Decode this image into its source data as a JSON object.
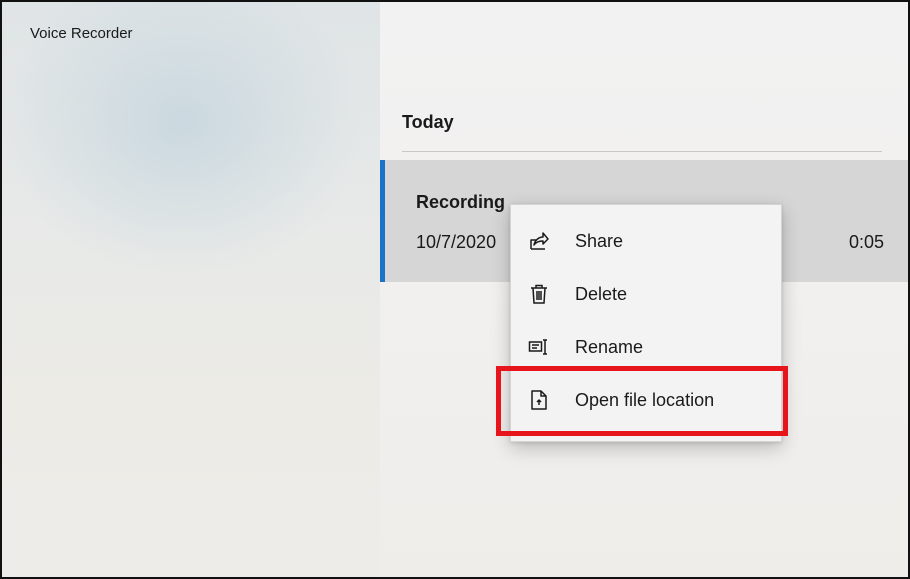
{
  "app": {
    "title": "Voice Recorder"
  },
  "list": {
    "section_header": "Today",
    "recordings": [
      {
        "name": "Recording",
        "date": "10/7/2020",
        "duration": "0:05",
        "selected": true
      }
    ]
  },
  "context_menu": {
    "items": [
      {
        "label": "Share",
        "icon": "share-icon"
      },
      {
        "label": "Delete",
        "icon": "trash-icon"
      },
      {
        "label": "Rename",
        "icon": "rename-icon"
      },
      {
        "label": "Open file location",
        "icon": "open-file-location-icon",
        "highlighted": true
      }
    ]
  },
  "colors": {
    "accent": "#1a73c7",
    "highlight_box": "#e8141b",
    "selected_row": "#d6d6d6"
  }
}
